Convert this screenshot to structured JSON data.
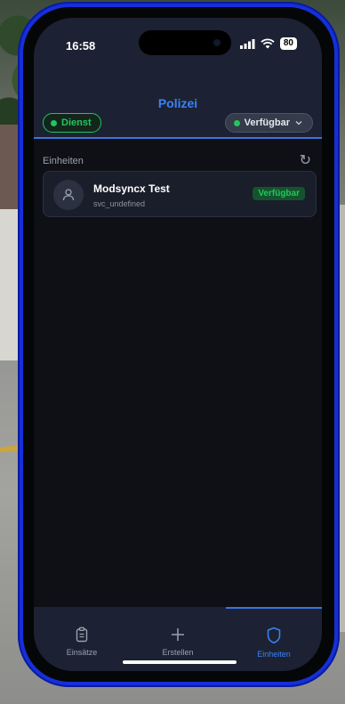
{
  "status_bar": {
    "time": "16:58",
    "battery": "80"
  },
  "header": {
    "title": "Polizei",
    "duty_label": "Dienst",
    "status_label": "Verfügbar",
    "colors": {
      "accent": "#3b82f6",
      "on_duty": "#22c55e"
    }
  },
  "units": {
    "section_label": "Einheiten",
    "refresh_icon": "refresh-icon",
    "items": [
      {
        "name": "Modsyncx Test",
        "id": "svc_undefined",
        "status": "Verfügbar",
        "icon": "person-icon"
      }
    ]
  },
  "tabs": [
    {
      "label": "Einsätze",
      "icon": "clipboard-icon",
      "active": false
    },
    {
      "label": "Erstellen",
      "icon": "plus-icon",
      "active": false
    },
    {
      "label": "Einheiten",
      "icon": "shield-icon",
      "active": true
    }
  ]
}
